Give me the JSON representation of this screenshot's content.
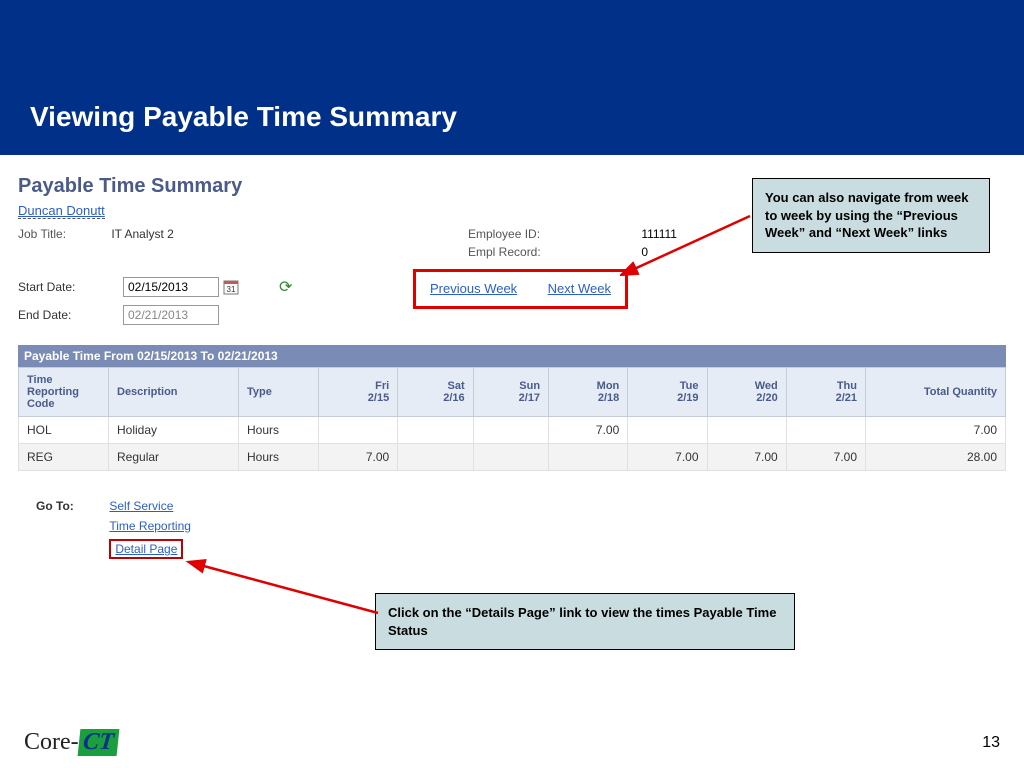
{
  "header": {
    "title": "Viewing Payable Time Summary"
  },
  "page": {
    "subtitle": "Payable Time Summary",
    "employee_name": "Duncan Donutt",
    "job_title_label": "Job Title:",
    "job_title": "IT Analyst 2",
    "emp_id_label": "Employee ID:",
    "emp_id": "111111",
    "empl_record_label": "Empl Record:",
    "empl_record": "0",
    "start_date_label": "Start Date:",
    "start_date": "02/15/2013",
    "end_date_label": "End Date:",
    "end_date": "02/21/2013",
    "prev_week": "Previous Week",
    "next_week": "Next Week"
  },
  "table": {
    "banner": "Payable Time From 02/15/2013 To 02/21/2013",
    "headers": {
      "trc": "Time Reporting Code",
      "desc": "Description",
      "type": "Type",
      "days": [
        "Fri\n2/15",
        "Sat\n2/16",
        "Sun\n2/17",
        "Mon\n2/18",
        "Tue\n2/19",
        "Wed\n2/20",
        "Thu\n2/21"
      ],
      "total": "Total Quantity"
    },
    "rows": [
      {
        "trc": "HOL",
        "desc": "Holiday",
        "type": "Hours",
        "vals": [
          "",
          "",
          "",
          "7.00",
          "",
          "",
          ""
        ],
        "total": "7.00"
      },
      {
        "trc": "REG",
        "desc": "Regular",
        "type": "Hours",
        "vals": [
          "7.00",
          "",
          "",
          "",
          "7.00",
          "7.00",
          "7.00"
        ],
        "total": "28.00"
      }
    ]
  },
  "goto": {
    "label": "Go To:",
    "links": {
      "self_service": "Self Service",
      "time_reporting": "Time Reporting",
      "detail_page": "Detail Page"
    }
  },
  "callouts": {
    "c1": "You can also navigate from week to week by using the “Previous Week” and “Next Week” links",
    "c2": "Click on the “Details Page” link to view the times Payable Time Status"
  },
  "footer": {
    "logo_prefix": "Core-",
    "logo_badge": "CT",
    "page": "13"
  }
}
